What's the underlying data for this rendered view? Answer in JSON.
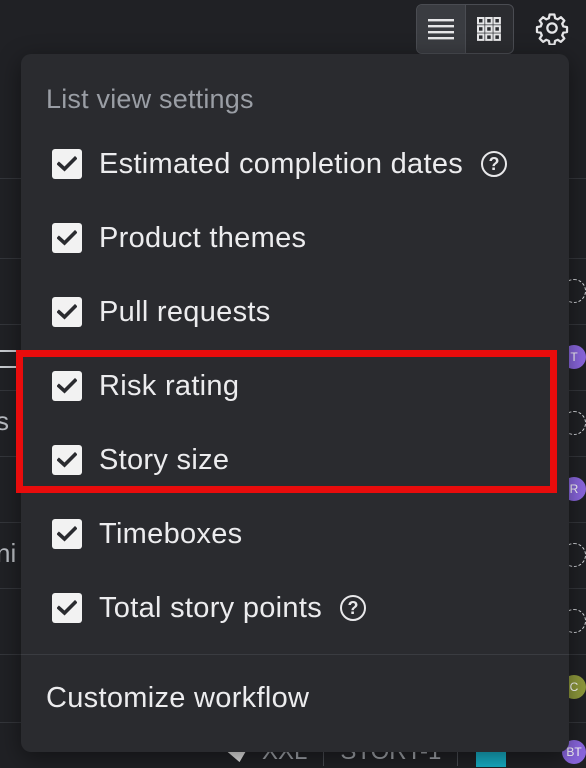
{
  "popup": {
    "title": "List view settings",
    "options": [
      {
        "label": "Estimated completion dates",
        "checked": true,
        "has_help": true
      },
      {
        "label": "Product themes",
        "checked": true,
        "has_help": false
      },
      {
        "label": "Pull requests",
        "checked": true,
        "has_help": false
      },
      {
        "label": "Risk rating",
        "checked": true,
        "has_help": false
      },
      {
        "label": "Story size",
        "checked": true,
        "has_help": false
      },
      {
        "label": "Timeboxes",
        "checked": true,
        "has_help": false
      },
      {
        "label": "Total story points",
        "checked": true,
        "has_help": true
      }
    ],
    "help_glyph": "?",
    "customize_label": "Customize workflow"
  },
  "toolbar": {
    "list_view_icon": "list-icon",
    "grid_view_icon": "grid-icon",
    "settings_icon": "gear-icon",
    "active_view": "list"
  },
  "background": {
    "edge_text": [
      "s",
      "ni"
    ],
    "avatars": [
      "T",
      "R",
      "C",
      "BT"
    ],
    "bottom_row": {
      "size": "XXL",
      "story_id": "STORY-1"
    }
  },
  "colors": {
    "highlight": "#e80c0c",
    "avatar_purple": "#8b67e0",
    "avatar_olive": "#8f9a3c",
    "accent_teal": "#17b0c8"
  }
}
